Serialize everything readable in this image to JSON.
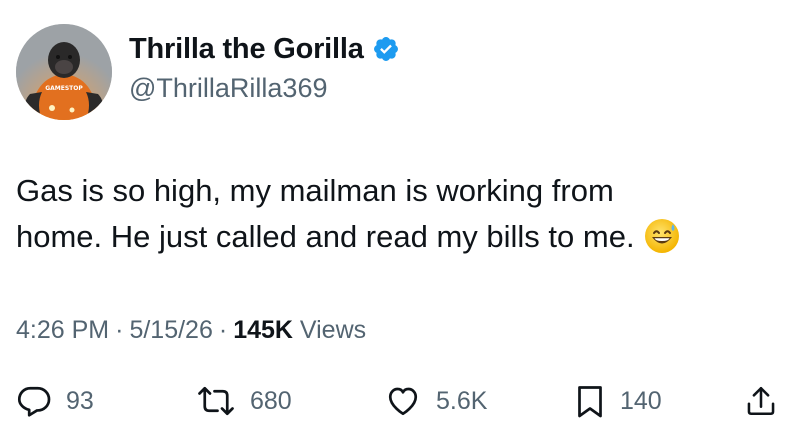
{
  "author": {
    "display_name": "Thrilla the Gorilla",
    "handle": "@ThrillaRilla369",
    "verified": true,
    "avatar": {
      "icon": "gorilla-avatar",
      "shirt_text": "GAMESTOP"
    }
  },
  "tweet": {
    "text_line_1": "Gas is so high, my mailman is working from",
    "text_line_2": "home. He just called and read my bills to me.",
    "emoji": "grinning-face-with-sweat-icon"
  },
  "meta": {
    "time": "4:26 PM",
    "separator": "·",
    "date": "5/15/26",
    "views_count": "145K",
    "views_label": "Views"
  },
  "actions": {
    "replies": "93",
    "reposts": "680",
    "likes": "5.6K",
    "bookmarks": "140"
  },
  "colors": {
    "text_primary": "#0f1419",
    "text_secondary": "#536471",
    "verified_blue": "#1d9bf0"
  }
}
